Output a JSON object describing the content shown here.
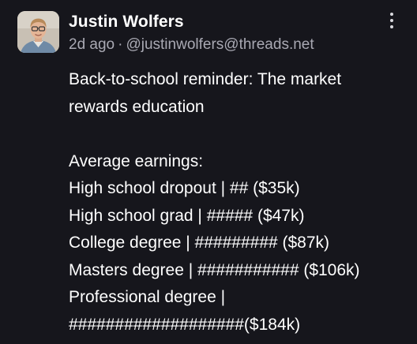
{
  "author": {
    "display_name": "Justin Wolfers",
    "time": "2d ago",
    "separator": "·",
    "handle": "@justinwolfers@threads.net"
  },
  "post": {
    "lines": [
      "Back-to-school reminder: The market",
      "rewards education",
      "",
      "Average earnings:",
      "High school dropout | ## ($35k)",
      "High school grad | ##### ($47k)",
      "College degree | ######### ($87k)",
      "Masters degree | ########### ($106k)",
      "Professional degree |",
      "###################($184k)"
    ]
  },
  "menu": {
    "icon": "more-vertical-icon"
  }
}
